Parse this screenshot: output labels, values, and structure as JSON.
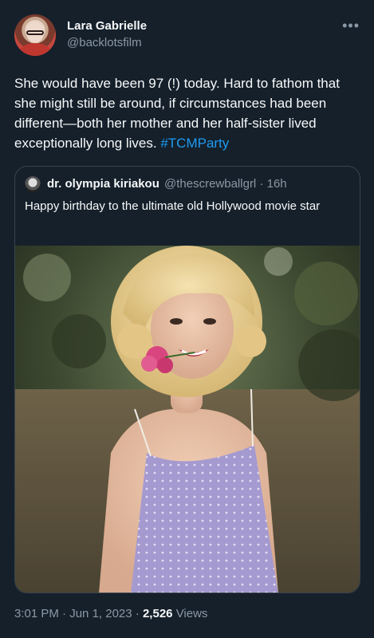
{
  "author": {
    "name": "Lara Gabrielle",
    "handle": "@backlotsfilm"
  },
  "more_icon": "more-horizontal-icon",
  "tweet": {
    "text": "She would have been 97 (!) today. Hard to fathom that she might still be around, if circumstances had been different—both her mother and her half-sister lived exceptionally long lives. ",
    "hashtag": "#TCMParty"
  },
  "quoted": {
    "author_name": "dr. olympia kiriakou",
    "handle": "@thescrewballgrl",
    "separator": "·",
    "time": "16h",
    "text": "Happy birthday to the ultimate old Hollywood movie star"
  },
  "footer": {
    "time": "3:01 PM",
    "sep1": "·",
    "date": "Jun 1, 2023",
    "sep2": "·",
    "views": "2,526",
    "views_label": "Views"
  },
  "colors": {
    "background": "#15202b",
    "text": "#f7f9f9",
    "muted": "#8b98a5",
    "link": "#1d9bf0",
    "border": "#38444d"
  }
}
